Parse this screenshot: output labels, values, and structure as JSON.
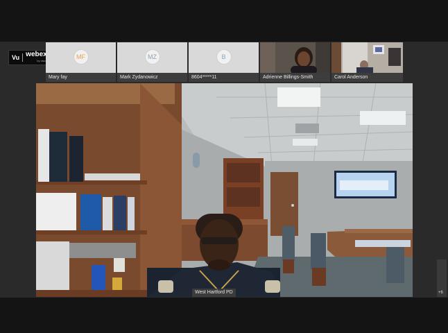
{
  "app": {
    "logo_prefix": "Vu",
    "logo_name": "webex",
    "logo_sub": "by cisco"
  },
  "participants": [
    {
      "initials": "MF",
      "name": "Mary fay",
      "initials_color": "#e8a24a"
    },
    {
      "initials": "MZ",
      "name": "Mark Zydanowicz",
      "initials_color": "#7aa0c8"
    },
    {
      "initials": "B",
      "name": "8604*****11",
      "initials_color": "#7aa0c8"
    },
    {
      "initials": "",
      "name": "Adrienne Billings-Smith"
    },
    {
      "initials": "",
      "name": "Carol Anderson"
    }
  ],
  "main_video": {
    "label": "West Hartford PD"
  },
  "overflow": {
    "count": "+6"
  },
  "colors": {
    "tile_bg": "#d9d9d9",
    "name_bar": "#3d3d3d",
    "stage_bg": "#2a2a2a"
  }
}
